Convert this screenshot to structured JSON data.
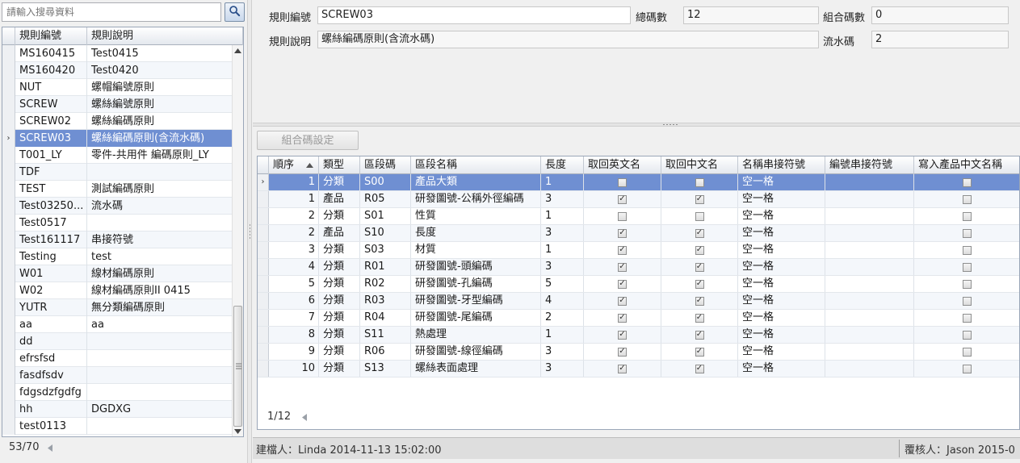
{
  "search": {
    "placeholder": "請輸入搜尋資料"
  },
  "left_grid": {
    "headers": [
      "規則編號",
      "規則說明"
    ],
    "rows": [
      {
        "code": "MS160415",
        "desc": "Test0415"
      },
      {
        "code": "MS160420",
        "desc": "Test0420"
      },
      {
        "code": "NUT",
        "desc": "螺帽編號原則"
      },
      {
        "code": "SCREW",
        "desc": "螺絲編號原則"
      },
      {
        "code": "SCREW02",
        "desc": "螺絲編碼原則"
      },
      {
        "code": "SCREW03",
        "desc": "螺絲編碼原則(含流水碼)",
        "selected": true
      },
      {
        "code": "T001_LY",
        "desc": "零件-共用件 編碼原則_LY"
      },
      {
        "code": "TDF",
        "desc": ""
      },
      {
        "code": "TEST",
        "desc": "測試編碼原則"
      },
      {
        "code": "Test03250...",
        "desc": "流水碼"
      },
      {
        "code": "Test0517",
        "desc": ""
      },
      {
        "code": "Test161117",
        "desc": "串接符號"
      },
      {
        "code": "Testing",
        "desc": "test"
      },
      {
        "code": "W01",
        "desc": "線材編碼原則"
      },
      {
        "code": "W02",
        "desc": "線材編碼原則II 0415"
      },
      {
        "code": "YUTR",
        "desc": "無分類編碼原則"
      },
      {
        "code": "aa",
        "desc": "aa"
      },
      {
        "code": "dd",
        "desc": ""
      },
      {
        "code": "efrsfsd",
        "desc": ""
      },
      {
        "code": "fasdfsdv",
        "desc": ""
      },
      {
        "code": "fdgsdzfgdfg",
        "desc": ""
      },
      {
        "code": "hh",
        "desc": "DGDXG"
      },
      {
        "code": "test0113",
        "desc": ""
      }
    ],
    "pager": "53/70"
  },
  "form": {
    "rule_no_label": "規則編號",
    "rule_no_value": "SCREW03",
    "total_codes_label": "總碼數",
    "total_codes_value": "12",
    "combo_count_label": "組合碼數",
    "combo_count_value": "0",
    "rule_desc_label": "規則說明",
    "rule_desc_value": "螺絲編碼原則(含流水碼)",
    "serial_label": "流水碼",
    "serial_value": "2"
  },
  "combo_button_label": "組合碼設定",
  "detail_grid": {
    "headers": [
      "順序",
      "類型",
      "區段碼",
      "區段名稱",
      "長度",
      "取回英文名",
      "取回中文名",
      "名稱串接符號",
      "編號串接符號",
      "寫入產品中文名稱"
    ],
    "rows": [
      {
        "seq": "1",
        "type": "分類",
        "code": "S00",
        "name": "產品大類",
        "len": "1",
        "en": false,
        "zh": false,
        "name_sep": "空一格",
        "no_sep": "",
        "write": false,
        "selected": true
      },
      {
        "seq": "1",
        "type": "產品",
        "code": "R05",
        "name": "研發圖號-公稱外徑編碼",
        "len": "3",
        "en": true,
        "zh": true,
        "name_sep": "空一格",
        "no_sep": "",
        "write": false
      },
      {
        "seq": "2",
        "type": "分類",
        "code": "S01",
        "name": "性質",
        "len": "1",
        "en": false,
        "zh": false,
        "name_sep": "空一格",
        "no_sep": "",
        "write": false
      },
      {
        "seq": "2",
        "type": "產品",
        "code": "S10",
        "name": "長度",
        "len": "3",
        "en": true,
        "zh": true,
        "name_sep": "空一格",
        "no_sep": "",
        "write": false
      },
      {
        "seq": "3",
        "type": "分類",
        "code": "S03",
        "name": "材質",
        "len": "1",
        "en": true,
        "zh": true,
        "name_sep": "空一格",
        "no_sep": "",
        "write": false
      },
      {
        "seq": "4",
        "type": "分類",
        "code": "R01",
        "name": "研發圖號-頭編碼",
        "len": "3",
        "en": true,
        "zh": true,
        "name_sep": "空一格",
        "no_sep": "",
        "write": false
      },
      {
        "seq": "5",
        "type": "分類",
        "code": "R02",
        "name": "研發圖號-孔編碼",
        "len": "5",
        "en": true,
        "zh": true,
        "name_sep": "空一格",
        "no_sep": "",
        "write": false
      },
      {
        "seq": "6",
        "type": "分類",
        "code": "R03",
        "name": "研發圖號-牙型編碼",
        "len": "4",
        "en": true,
        "zh": true,
        "name_sep": "空一格",
        "no_sep": "",
        "write": false
      },
      {
        "seq": "7",
        "type": "分類",
        "code": "R04",
        "name": "研發圖號-尾編碼",
        "len": "2",
        "en": true,
        "zh": true,
        "name_sep": "空一格",
        "no_sep": "",
        "write": false
      },
      {
        "seq": "8",
        "type": "分類",
        "code": "S11",
        "name": "熱處理",
        "len": "1",
        "en": true,
        "zh": true,
        "name_sep": "空一格",
        "no_sep": "",
        "write": false
      },
      {
        "seq": "9",
        "type": "分類",
        "code": "R06",
        "name": "研發圖號-線徑編碼",
        "len": "3",
        "en": true,
        "zh": true,
        "name_sep": "空一格",
        "no_sep": "",
        "write": false
      },
      {
        "seq": "10",
        "type": "分類",
        "code": "S13",
        "name": "螺絲表面處理",
        "len": "3",
        "en": true,
        "zh": true,
        "name_sep": "空一格",
        "no_sep": "",
        "write": false
      }
    ],
    "pager": "1/12"
  },
  "status": {
    "creator": "建檔人：Linda 2014-11-13 15:02:00",
    "reviewer": "覆核人：Jason 2015-0"
  },
  "colors": {
    "selection": "#6f8fd2",
    "alt_row": "#f4f7fb",
    "grid_border": "#9aa6b8"
  }
}
